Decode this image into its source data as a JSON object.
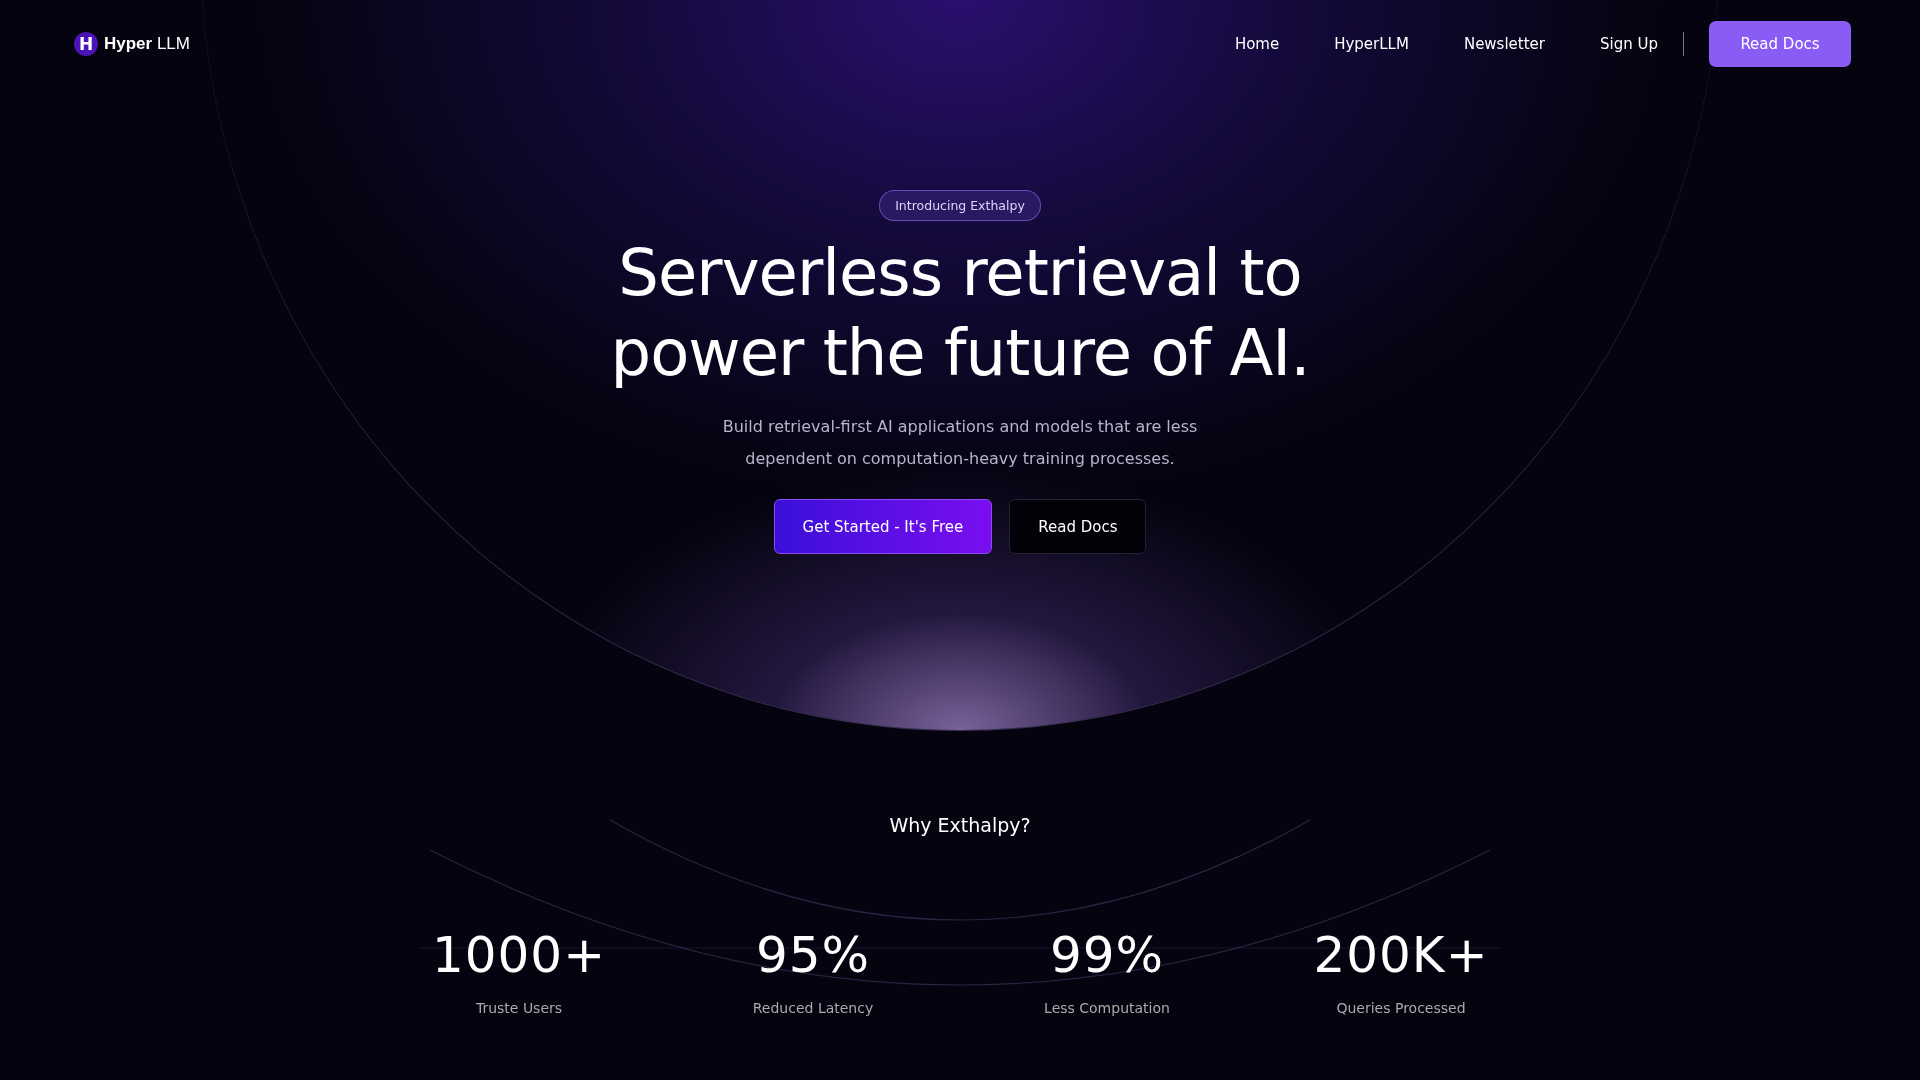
{
  "nav": {
    "logo_letter": "H",
    "brand": "**Hyper** LLM",
    "links": [
      "Home",
      "HyperLLM",
      "Newsletter",
      "Sign Up"
    ],
    "button": "Read Docs"
  },
  "hero": {
    "badge": "Introducing Exthalpy",
    "title_lines": [
      "Serverless retrieval to",
      "power the future of AI."
    ],
    "subtitle_lines": [
      "Build retrieval-first AI applications and models that are less",
      "dependent on computation-heavy training processes."
    ],
    "buttons": [
      {
        "kind": "primary",
        "label": "Get Started - It's Free"
      },
      {
        "kind": "secondary",
        "label": "Read Docs"
      }
    ]
  },
  "why": {
    "heading": "Why Exthalpy?",
    "stats": [
      {
        "value": "1000+",
        "label": "Truste Users"
      },
      {
        "value": "95%",
        "label": "Reduced Latency"
      },
      {
        "value": "99%",
        "label": "Less Computation"
      },
      {
        "value": "200K+",
        "label": "Queries Processed"
      }
    ]
  }
}
